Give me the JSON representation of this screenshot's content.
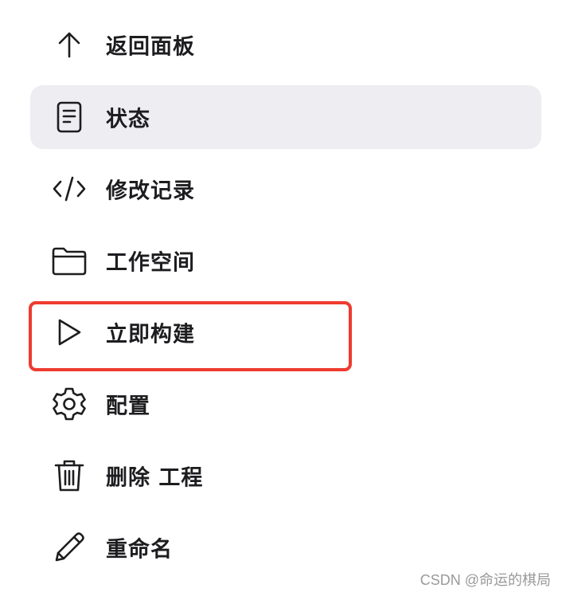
{
  "menu": {
    "items": [
      {
        "label": "返回面板",
        "icon": "arrow-up-icon",
        "active": false
      },
      {
        "label": "状态",
        "icon": "document-icon",
        "active": true
      },
      {
        "label": "修改记录",
        "icon": "code-icon",
        "active": false
      },
      {
        "label": "工作空间",
        "icon": "folder-icon",
        "active": false
      },
      {
        "label": "立即构建",
        "icon": "play-icon",
        "active": false
      },
      {
        "label": "配置",
        "icon": "gear-icon",
        "active": false
      },
      {
        "label": "删除 工程",
        "icon": "trash-icon",
        "active": false
      },
      {
        "label": "重命名",
        "icon": "pencil-icon",
        "active": false
      }
    ]
  },
  "annotation": {
    "highlight_color": "#ee3b2f",
    "highlighted_item": "立即构建"
  },
  "colors": {
    "active_background": "#ededf2",
    "text": "#1d1d20"
  },
  "watermark": {
    "text": "CSDN @命运的棋局"
  }
}
